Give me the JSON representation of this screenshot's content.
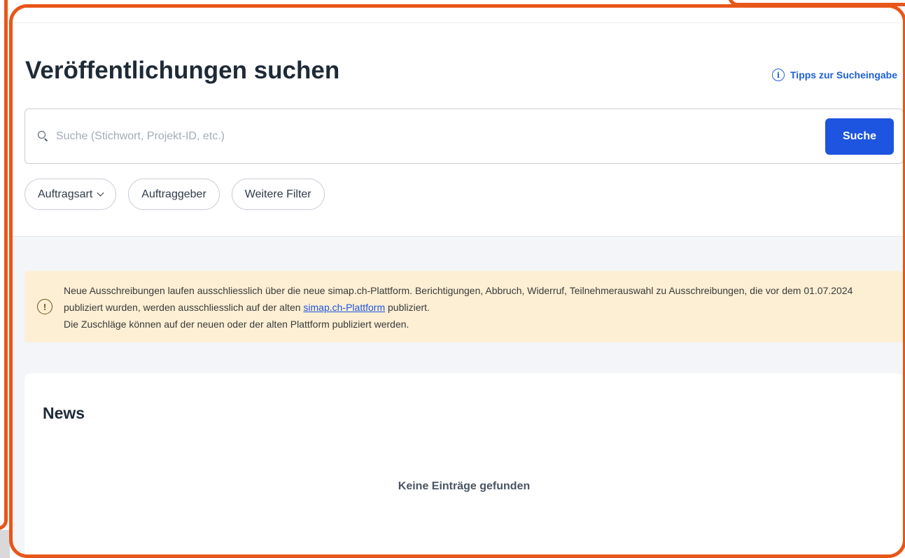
{
  "page": {
    "title": "Veröffentlichungen suchen",
    "tips_link": "Tipps zur Sucheingabe"
  },
  "search": {
    "placeholder": "Suche (Stichwort, Projekt-ID, etc.)",
    "value": "",
    "button_label": "Suche"
  },
  "filters": [
    {
      "label": "Auftragsart",
      "has_dropdown": true
    },
    {
      "label": "Auftraggeber",
      "has_dropdown": false
    },
    {
      "label": "Weitere Filter",
      "has_dropdown": false
    }
  ],
  "notice": {
    "text_part1": "Neue Ausschreibungen laufen ausschliesslich über die neue simap.ch-Plattform. Berichtigungen, Abbruch, Widerruf, Teilnehmerauswahl zu Ausschreibungen, die vor dem 01.07.2024 publiziert wurden, werden ausschliesslich auf der alten ",
    "link_label": "simap.ch-Plattform",
    "text_part2": " publiziert.",
    "line2": "Die Zuschläge können auf der neuen oder der alten Plattform publiziert werden."
  },
  "news": {
    "title": "News",
    "empty_text": "Keine Einträge gefunden"
  },
  "colors": {
    "accent": "#1d54e0",
    "annotation_frame": "#e8561a",
    "notice_bg": "#fcefd4",
    "title_text": "#1f2a37"
  },
  "icons": [
    "info-icon",
    "search-icon",
    "chevron-down-icon",
    "warning-icon"
  ]
}
